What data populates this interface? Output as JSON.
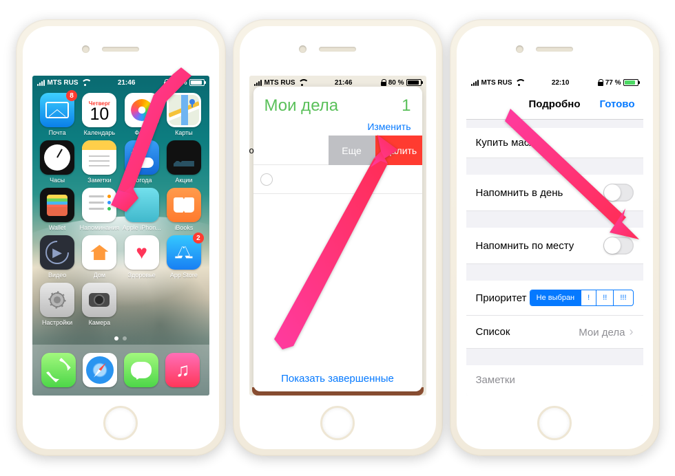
{
  "status1": {
    "carrier": "MTS RUS",
    "time": "21:46",
    "battery": "80 %",
    "battery_fill": 80
  },
  "status2": {
    "carrier": "MTS RUS",
    "time": "21:46",
    "battery": "80 %",
    "battery_fill": 80
  },
  "status3": {
    "carrier": "MTS RUS",
    "time": "22:10",
    "battery": "77 %",
    "battery_fill": 77,
    "battery_color": "#4cd964"
  },
  "homescreen": {
    "cal_day": "Четверг",
    "cal_date": "10",
    "apps": [
      {
        "name": "Почта",
        "badge": "8"
      },
      {
        "name": "Календарь"
      },
      {
        "name": "Фото"
      },
      {
        "name": "Карты"
      },
      {
        "name": "Часы"
      },
      {
        "name": "Заметки"
      },
      {
        "name": "Погода"
      },
      {
        "name": "Акции"
      },
      {
        "name": "Wallet"
      },
      {
        "name": "Напоминания"
      },
      {
        "name": "Apple iPhon..."
      },
      {
        "name": "iBooks"
      },
      {
        "name": "Видео"
      },
      {
        "name": "Дом"
      },
      {
        "name": "Здоровье"
      },
      {
        "name": "App Store",
        "badge": "2"
      },
      {
        "name": "Настройки"
      },
      {
        "name": "Камера"
      }
    ]
  },
  "reminders": {
    "title": "Мои дела",
    "count": "1",
    "edit": "Изменить",
    "swipe_more": "Еще",
    "swipe_delete": "Удалить",
    "footer": "Показать завершенные"
  },
  "detail": {
    "nav_title": "Подробно",
    "done": "Готово",
    "item": "Купить масло",
    "remind_day": "Напомнить в день",
    "remind_place": "Напомнить по месту",
    "priority_label": "Приоритет",
    "priority_opts": [
      "Не выбран",
      "!",
      "!!",
      "!!!"
    ],
    "list_label": "Список",
    "list_value": "Мои дела",
    "notes": "Заметки"
  }
}
